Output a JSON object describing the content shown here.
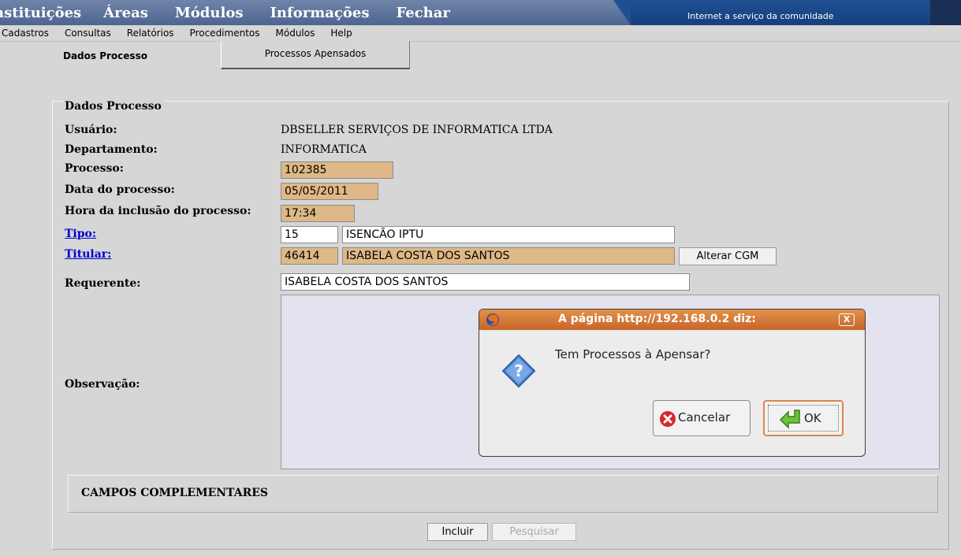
{
  "menu": {
    "items": [
      "nstituições",
      "Áreas",
      "Módulos",
      "Informações",
      "Fechar"
    ],
    "tagline": "Internet a serviço da comunidade"
  },
  "submenu": [
    "Cadastros",
    "Consultas",
    "Relatórios",
    "Procedimentos",
    "Módulos",
    "Help"
  ],
  "tabs": {
    "dados": "Dados Processo",
    "apensados": "Processos Apensados"
  },
  "form": {
    "legend": "Dados Processo",
    "usuario_label": "Usuário:",
    "usuario_value": "DBSELLER SERVIÇOS DE INFORMATICA LTDA",
    "departamento_label": "Departamento:",
    "departamento_value": "INFORMATICA",
    "processo_label": "Processo:",
    "processo_value": "102385",
    "data_label": "Data do processo:",
    "data_value": "05/05/2011",
    "hora_label": "Hora da inclusão do processo:",
    "hora_value": "17:34",
    "tipo_label": "Tipo:",
    "tipo_code": "15",
    "tipo_desc": "ISENCÃO IPTU",
    "titular_label": "Titular:",
    "titular_code": "46414",
    "titular_name": "ISABELA COSTA DOS SANTOS",
    "alterar_cgm": "Alterar CGM",
    "requerente_label": "Requerente:",
    "requerente_value": "ISABELA COSTA DOS SANTOS",
    "observacao_label": "Observação:",
    "campos": "CAMPOS COMPLEMENTARES",
    "incluir": "Incluir",
    "pesquisar": "Pesquisar"
  },
  "dialog": {
    "title": "A página http://192.168.0.2 diz:",
    "message": "Tem Processos à Apensar?",
    "cancel": "Cancelar",
    "ok": "OK",
    "close": "X"
  },
  "colors": {
    "readonly_field": "#deb887",
    "dialog_title": "#d47a3a",
    "link": "#0000cc"
  }
}
